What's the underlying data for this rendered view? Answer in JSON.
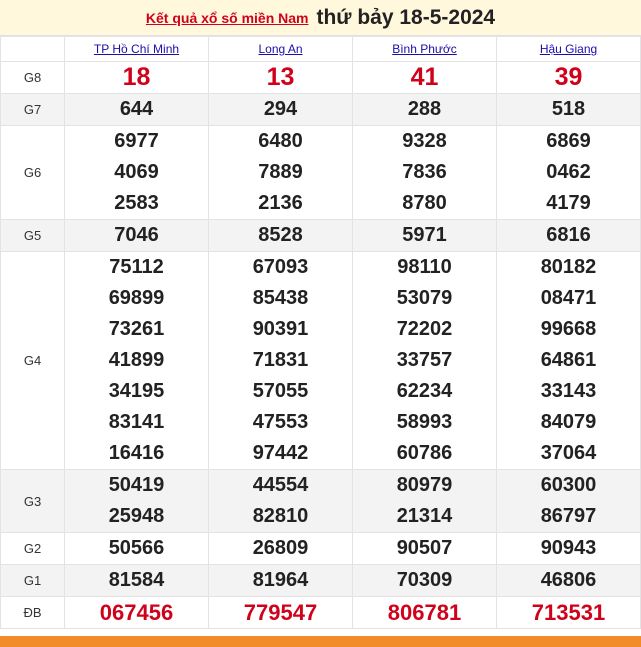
{
  "header": {
    "link_text": "Kết quả xổ số miền Nam",
    "date_text": "thứ bảy 18-5-2024"
  },
  "provinces": [
    "TP Hồ Chí Minh",
    "Long An",
    "Bình Phước",
    "Hậu Giang"
  ],
  "prizes": [
    {
      "label": "G8",
      "style": "red",
      "alt": false,
      "cols": [
        [
          "18"
        ],
        [
          "13"
        ],
        [
          "41"
        ],
        [
          "39"
        ]
      ]
    },
    {
      "label": "G7",
      "style": "normal",
      "alt": true,
      "cols": [
        [
          "644"
        ],
        [
          "294"
        ],
        [
          "288"
        ],
        [
          "518"
        ]
      ]
    },
    {
      "label": "G6",
      "style": "normal",
      "alt": false,
      "cols": [
        [
          "6977",
          "4069",
          "2583"
        ],
        [
          "6480",
          "7889",
          "2136"
        ],
        [
          "9328",
          "7836",
          "8780"
        ],
        [
          "6869",
          "0462",
          "4179"
        ]
      ]
    },
    {
      "label": "G5",
      "style": "normal",
      "alt": true,
      "cols": [
        [
          "7046"
        ],
        [
          "8528"
        ],
        [
          "5971"
        ],
        [
          "6816"
        ]
      ]
    },
    {
      "label": "G4",
      "style": "normal",
      "alt": false,
      "cols": [
        [
          "75112",
          "69899",
          "73261",
          "41899",
          "34195",
          "83141",
          "16416"
        ],
        [
          "67093",
          "85438",
          "90391",
          "71831",
          "57055",
          "47553",
          "97442"
        ],
        [
          "98110",
          "53079",
          "72202",
          "33757",
          "62234",
          "58993",
          "60786"
        ],
        [
          "80182",
          "08471",
          "99668",
          "64861",
          "33143",
          "84079",
          "37064"
        ]
      ]
    },
    {
      "label": "G3",
      "style": "normal",
      "alt": true,
      "cols": [
        [
          "50419",
          "25948"
        ],
        [
          "44554",
          "82810"
        ],
        [
          "80979",
          "21314"
        ],
        [
          "60300",
          "86797"
        ]
      ]
    },
    {
      "label": "G2",
      "style": "normal",
      "alt": false,
      "cols": [
        [
          "50566"
        ],
        [
          "26809"
        ],
        [
          "90507"
        ],
        [
          "90943"
        ]
      ]
    },
    {
      "label": "G1",
      "style": "normal",
      "alt": true,
      "cols": [
        [
          "81584"
        ],
        [
          "81964"
        ],
        [
          "70309"
        ],
        [
          "46806"
        ]
      ]
    },
    {
      "label": "ĐB",
      "style": "red-db",
      "alt": false,
      "cols": [
        [
          "067456"
        ],
        [
          "779547"
        ],
        [
          "806781"
        ],
        [
          "713531"
        ]
      ]
    }
  ],
  "colors": {
    "accent_red": "#d0021b",
    "link_blue": "#1a0dab",
    "footer_orange": "#f28c28",
    "header_bg": "#fff8dc"
  }
}
